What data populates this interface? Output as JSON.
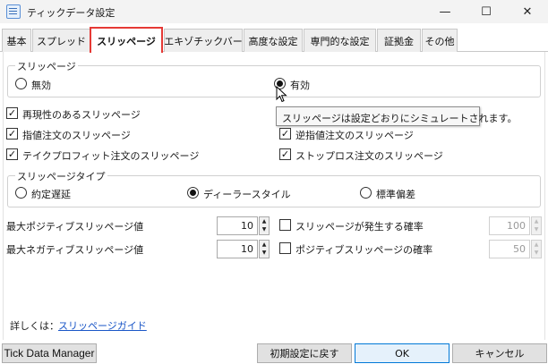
{
  "window": {
    "title": "ティックデータ設定",
    "minimize_glyph": "—",
    "maximize_glyph": "☐",
    "close_glyph": "✕"
  },
  "tabs": [
    {
      "label": "基本"
    },
    {
      "label": "スプレッド"
    },
    {
      "label": "スリッページ",
      "active": true
    },
    {
      "label": "エキゾチックバー"
    },
    {
      "label": "高度な設定"
    },
    {
      "label": "専門的な設定"
    },
    {
      "label": "証拠金"
    },
    {
      "label": "その他"
    }
  ],
  "slippage_group": {
    "legend": "スリッページ",
    "option_none": "無効",
    "option_enabled": "有効",
    "selected": "有効"
  },
  "tooltip": "スリッページは設定どおりにシミュレートされます。",
  "checkboxes": {
    "reproducible": {
      "label": "再現性のあるスリッページ",
      "checked": true
    },
    "limit_orders": {
      "label": "指値注文のスリッページ",
      "checked": true
    },
    "stop_limit_orders": {
      "label": "逆指値注文のスリッページ",
      "checked": true
    },
    "take_profit": {
      "label": "テイクプロフィット注文のスリッページ",
      "checked": true
    },
    "stop_loss": {
      "label": "ストップロス注文のスリッページ",
      "checked": true
    }
  },
  "slippage_type_group": {
    "legend": "スリッページタイプ",
    "option_1": "約定遅延",
    "option_2": "ディーラースタイル",
    "option_3": "標準偏差",
    "selected": "ディーラースタイル"
  },
  "max_positive": {
    "label": "最大ポジティブスリッページ値",
    "value": "10"
  },
  "max_negative": {
    "label": "最大ネガティブスリッページ値",
    "value": "10"
  },
  "slippage_probability": {
    "label": "スリッページが発生する確率",
    "checked": false,
    "value": "100"
  },
  "positive_probability": {
    "label": "ポジティブスリッページの確率",
    "checked": false,
    "value": "50"
  },
  "details": {
    "prefix": "詳しくは：",
    "link": "スリッページガイド"
  },
  "bottom": {
    "manager_label": "Tick Data Manager",
    "reset_label": "初期設定に戻す",
    "ok_label": "OK",
    "cancel_label": "キャンセル"
  }
}
